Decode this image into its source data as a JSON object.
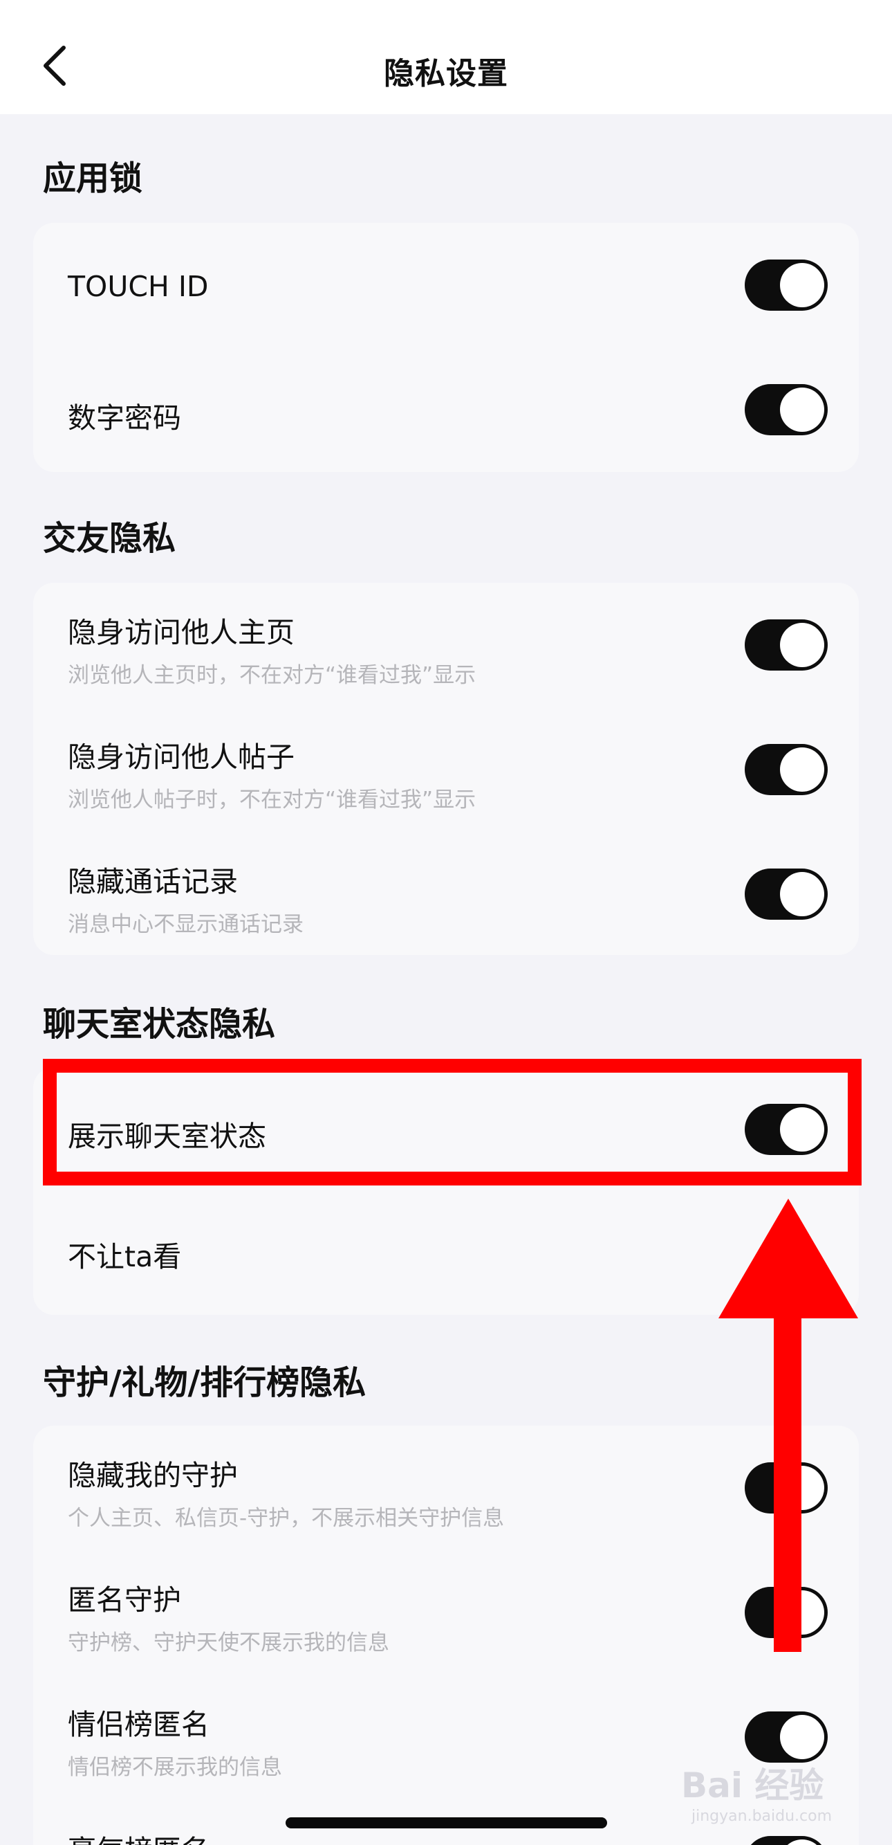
{
  "nav": {
    "title": "隐私设置"
  },
  "sections": {
    "app_lock": {
      "title": "应用锁",
      "rows": [
        {
          "title": "TOUCH ID",
          "on": true
        },
        {
          "title": "数字密码",
          "on": true
        }
      ]
    },
    "friend_privacy": {
      "title": "交友隐私",
      "rows": [
        {
          "title": "隐身访问他人主页",
          "subtitle": "浏览他人主页时，不在对方“谁看过我”显示",
          "on": true
        },
        {
          "title": "隐身访问他人帖子",
          "subtitle": "浏览他人帖子时，不在对方“谁看过我”显示",
          "on": true
        },
        {
          "title": "隐藏通话记录",
          "subtitle": "消息中心不显示通话记录",
          "on": true
        }
      ]
    },
    "chatroom_privacy": {
      "title": "聊天室状态隐私",
      "rows": [
        {
          "title": "展示聊天室状态",
          "on": true
        },
        {
          "title": "不让ta看"
        }
      ]
    },
    "guard_privacy": {
      "title": "守护/礼物/排行榜隐私",
      "rows": [
        {
          "title": "隐藏我的守护",
          "subtitle": "个人主页、私信页-守护，不展示相关守护信息",
          "on": true
        },
        {
          "title": "匿名守护",
          "subtitle": "守护榜、守护天使不展示我的信息",
          "on": true
        },
        {
          "title": "情侣榜匿名",
          "subtitle": "情侣榜不展示我的信息",
          "on": true
        },
        {
          "title": "豪气榜匿名",
          "on": true
        }
      ]
    }
  },
  "watermark": {
    "text": "Bai 经验",
    "sub": "jingyan.baidu.com"
  }
}
